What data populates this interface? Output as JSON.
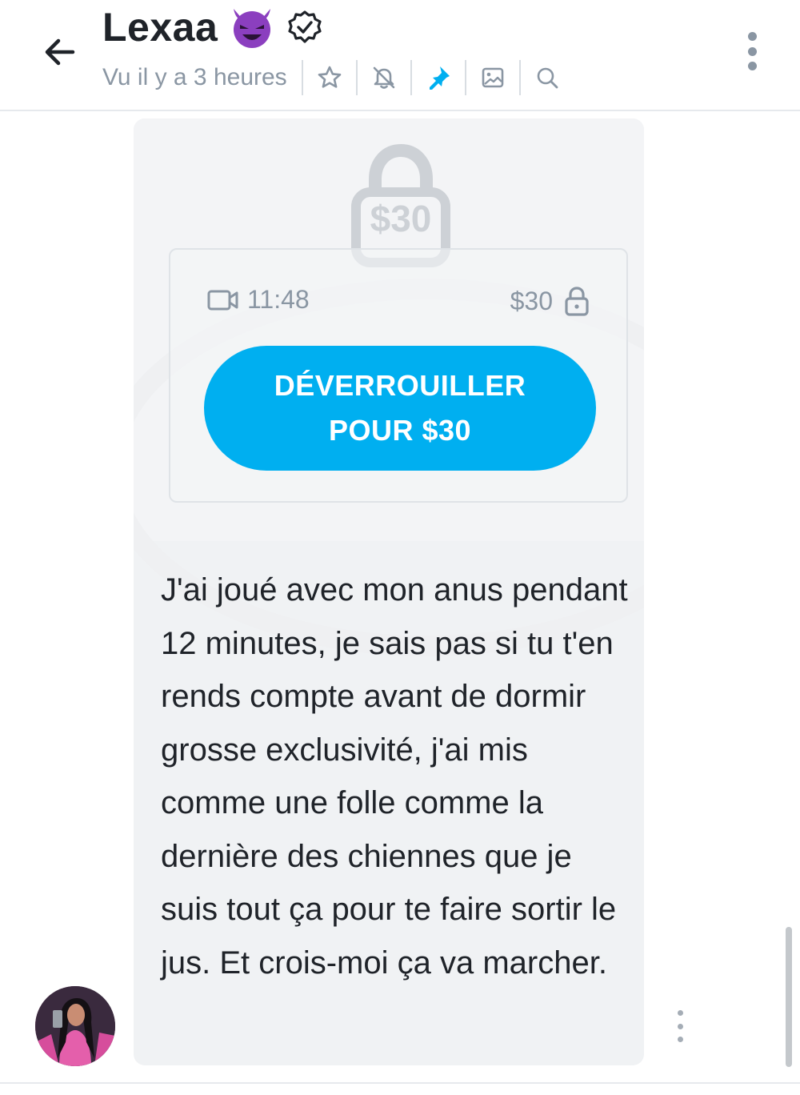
{
  "header": {
    "name": "Lexaa",
    "status": "Vu il y a 3 heures",
    "icons": [
      "back-arrow-icon",
      "devil-emoji-icon",
      "verified-badge-icon",
      "star-icon",
      "bell-off-icon",
      "pin-icon",
      "gallery-icon",
      "search-icon",
      "more-vertical-icon"
    ]
  },
  "message": {
    "media": {
      "lock_price": "$30",
      "video_duration": "11:48",
      "price": "$30",
      "unlock_label": "DÉVERROUILLER\nPOUR $30"
    },
    "text": "J'ai joué avec mon anus pendant 12 minutes, je sais pas si tu t'en rends compte avant de dormir grosse exclusivité, j'ai mis comme une folle comme la dernière des chiennes que je suis tout ça pour te faire sortir le jus. Et crois-moi ça va marcher."
  },
  "colors": {
    "accent": "#00aff0",
    "muted": "#8a96a3",
    "bubble": "#f0f2f4",
    "devil": "#8b3fbf"
  }
}
